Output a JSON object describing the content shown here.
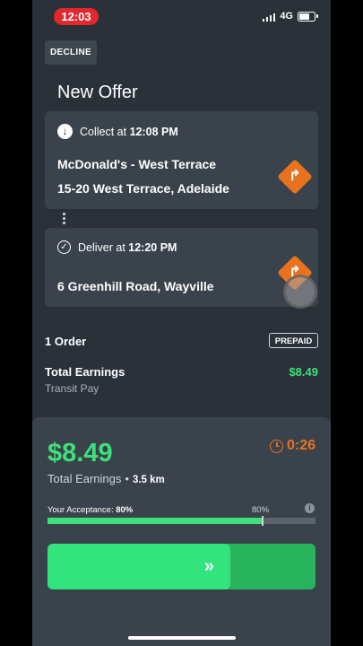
{
  "status_bar": {
    "time": "12:03",
    "network": "4G"
  },
  "header": {
    "decline_label": "DECLINE",
    "title": "New Offer"
  },
  "pickup": {
    "prefix": "Collect at",
    "time": "12:08 PM",
    "name": "McDonald's - West Terrace",
    "address": "15-20 West Terrace, Adelaide",
    "icon": "arrow-down-circle-icon"
  },
  "dropoff": {
    "prefix": "Deliver at",
    "time": "12:20 PM",
    "address": "6 Greenhill Road, Wayville",
    "icon": "check-circle-icon"
  },
  "order": {
    "count_label": "1 Order",
    "badge": "PREPAID"
  },
  "earnings": {
    "label": "Total Earnings",
    "value": "$8.49",
    "sub": "Transit Pay"
  },
  "sheet": {
    "amount": "$8.49",
    "timer": "0:26",
    "earnings_label": "Total Earnings",
    "distance": "3.5 km",
    "acceptance_label": "Your Acceptance:",
    "acceptance_value": "80%",
    "acceptance_marker": "80%",
    "acceptance_fraction": 0.8,
    "slider_icon": "»"
  },
  "colors": {
    "accent_green": "#3ee07b",
    "accent_orange": "#e8731f",
    "status_red": "#e0282f",
    "background": "#2a3139",
    "card": "#3a434c"
  }
}
